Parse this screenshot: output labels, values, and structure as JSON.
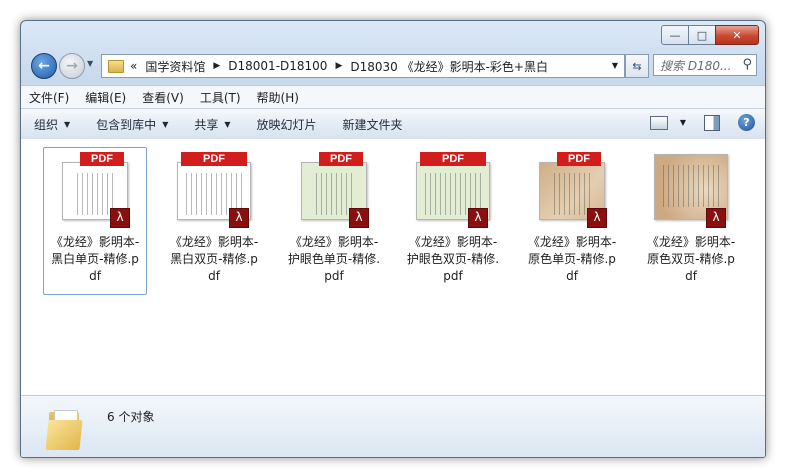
{
  "window": {
    "caption": {
      "minimize": "—",
      "maximize": "□",
      "close": "✕"
    }
  },
  "nav": {
    "back_icon": "arrow-left-icon",
    "forward_icon": "arrow-right-icon",
    "chevron": "«",
    "breadcrumbs": [
      "国学资料馆",
      "D18001-D18100",
      "D18030 《龙经》影明本-彩色+黑白"
    ],
    "search_placeholder": "搜索 D180..."
  },
  "menu": [
    "文件(F)",
    "编辑(E)",
    "查看(V)",
    "工具(T)",
    "帮助(H)"
  ],
  "toolbar": {
    "organize": "组织",
    "include_library": "包含到库中",
    "share": "共享",
    "slideshow": "放映幻灯片",
    "new_folder": "新建文件夹"
  },
  "files": [
    {
      "name": "《龙经》影明本-黑白单页-精修.pdf",
      "bg": "#ffffff",
      "selected": true,
      "tag_wide": false
    },
    {
      "name": "《龙经》影明本-黑白双页-精修.pdf",
      "bg": "#ffffff",
      "selected": false,
      "tag_wide": true
    },
    {
      "name": "《龙经》影明本-护眼色单页-精修.pdf",
      "bg": "#e3edd3",
      "selected": false,
      "tag_wide": false
    },
    {
      "name": "《龙经》影明本-护眼色双页-精修.pdf",
      "bg": "#e3edd3",
      "selected": false,
      "tag_wide": true
    },
    {
      "name": "《龙经》影明本-原色单页-精修.pdf",
      "bg": "#d9c0a0",
      "selected": false,
      "tag_wide": false
    },
    {
      "name": "《龙经》影明本-原色双页-精修.pdf",
      "bg": "#d5b896",
      "selected": false,
      "tag_wide": true
    }
  ],
  "file_tag": "PDF",
  "status": {
    "count": "6 个对象"
  },
  "colors": {
    "pdf_red": "#d21d1d",
    "selection": "#7da2ce"
  }
}
